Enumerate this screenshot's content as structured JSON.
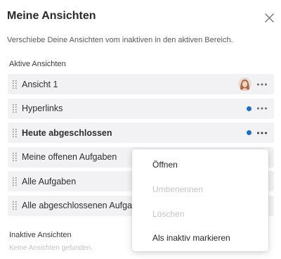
{
  "dialog": {
    "title": "Meine Ansichten",
    "subtitle": "Verschiebe Deine Ansichten vom inaktiven in den aktiven Bereich."
  },
  "active_section": {
    "label": "Aktive Ansichten",
    "items": [
      {
        "label": "Ansicht 1",
        "bold": false,
        "indicator": "avatar"
      },
      {
        "label": "Hyperlinks",
        "bold": false,
        "indicator": "dot"
      },
      {
        "label": "Heute abgeschlossen",
        "bold": true,
        "indicator": "dot"
      },
      {
        "label": "Meine offenen Aufgaben",
        "bold": false,
        "indicator": "none"
      },
      {
        "label": "Alle Aufgaben",
        "bold": false,
        "indicator": "none"
      },
      {
        "label": "Alle abgeschlossenen Aufgaben",
        "bold": false,
        "indicator": "none"
      }
    ]
  },
  "inactive_section": {
    "label": "Inaktive Ansichten",
    "empty_text": "Keine Ansichten gefunden."
  },
  "context_menu": {
    "items": [
      {
        "label": "Öffnen",
        "enabled": true
      },
      {
        "label": "Umbenennen",
        "enabled": false
      },
      {
        "label": "Löschen",
        "enabled": false
      },
      {
        "label": "Als inaktiv markieren",
        "enabled": true
      }
    ]
  },
  "colors": {
    "accent_dot": "#1e6fc1",
    "row_background": "#f2f2f4"
  },
  "icons": {
    "close": "close-icon",
    "drag": "drag-handle-icon",
    "more": "more-horizontal-icon"
  }
}
